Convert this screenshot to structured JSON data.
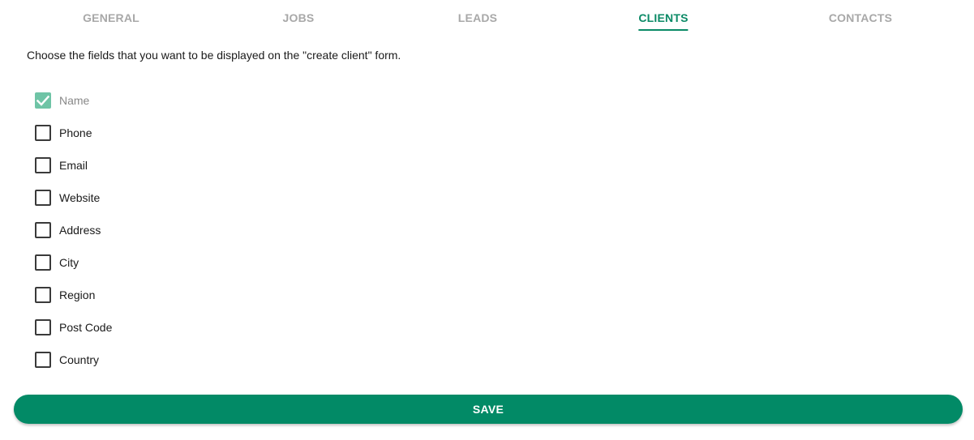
{
  "tabs": [
    {
      "label": "GENERAL",
      "active": false
    },
    {
      "label": "JOBS",
      "active": false
    },
    {
      "label": "LEADS",
      "active": false
    },
    {
      "label": "CLIENTS",
      "active": true
    },
    {
      "label": "CONTACTS",
      "active": false
    }
  ],
  "intro_text": "Choose the fields that you want to be displayed on the \"create client\" form.",
  "fields": [
    {
      "label": "Name",
      "checked": true,
      "disabled": true
    },
    {
      "label": "Phone",
      "checked": false,
      "disabled": false
    },
    {
      "label": "Email",
      "checked": false,
      "disabled": false
    },
    {
      "label": "Website",
      "checked": false,
      "disabled": false
    },
    {
      "label": "Address",
      "checked": false,
      "disabled": false
    },
    {
      "label": "City",
      "checked": false,
      "disabled": false
    },
    {
      "label": "Region",
      "checked": false,
      "disabled": false
    },
    {
      "label": "Post Code",
      "checked": false,
      "disabled": false
    },
    {
      "label": "Country",
      "checked": false,
      "disabled": false
    }
  ],
  "save_label": "SAVE",
  "colors": {
    "accent": "#028a66",
    "checked_fill": "#6fc4a6",
    "inactive_tab": "#a8a8a8"
  }
}
